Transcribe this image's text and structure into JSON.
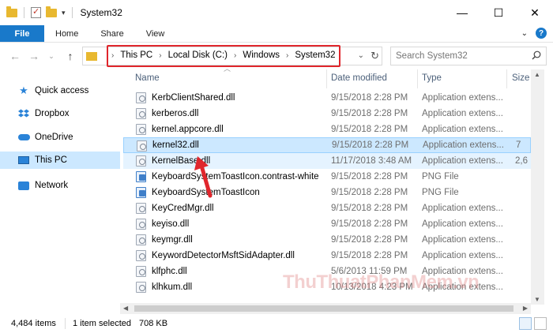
{
  "window": {
    "title": "System32",
    "controls": {
      "minimize": "—",
      "maximize": "☐",
      "close": "✕"
    }
  },
  "ribbon": {
    "tabs": [
      "File",
      "Home",
      "Share",
      "View"
    ],
    "expand_icon": "chevron-down-icon",
    "help_label": "?"
  },
  "address": {
    "crumbs": [
      "This PC",
      "Local Disk (C:)",
      "Windows",
      "System32"
    ],
    "highlight_color": "#e0262c"
  },
  "search": {
    "placeholder": "Search System32"
  },
  "sidebar": {
    "items": [
      {
        "label": "Quick access",
        "icon": "star-icon"
      },
      {
        "label": "Dropbox",
        "icon": "dropbox-icon"
      },
      {
        "label": "OneDrive",
        "icon": "cloud-icon"
      },
      {
        "label": "This PC",
        "icon": "computer-icon",
        "selected": true
      },
      {
        "label": "Network",
        "icon": "network-icon"
      }
    ]
  },
  "columns": {
    "name": "Name",
    "date": "Date modified",
    "type": "Type",
    "size": "Size"
  },
  "files": [
    {
      "name": "KerbClientShared.dll",
      "date": "9/15/2018 2:28 PM",
      "type": "Application extens...",
      "size": "",
      "icon": "dll-file-icon"
    },
    {
      "name": "kerberos.dll",
      "date": "9/15/2018 2:28 PM",
      "type": "Application extens...",
      "size": "",
      "icon": "dll-file-icon"
    },
    {
      "name": "kernel.appcore.dll",
      "date": "9/15/2018 2:28 PM",
      "type": "Application extens...",
      "size": "",
      "icon": "dll-file-icon"
    },
    {
      "name": "kernel32.dll",
      "date": "9/15/2018 2:28 PM",
      "type": "Application extens...",
      "size": "7",
      "icon": "dll-file-icon",
      "selected": true
    },
    {
      "name": "KernelBase.dll",
      "date": "11/17/2018 3:48 AM",
      "type": "Application extens...",
      "size": "2,6",
      "icon": "dll-file-icon",
      "hover": true
    },
    {
      "name": "KeyboardSystemToastIcon.contrast-white",
      "date": "9/15/2018 2:28 PM",
      "type": "PNG File",
      "size": "",
      "icon": "png-file-icon"
    },
    {
      "name": "KeyboardSystemToastIcon",
      "date": "9/15/2018 2:28 PM",
      "type": "PNG File",
      "size": "",
      "icon": "png-file-icon"
    },
    {
      "name": "KeyCredMgr.dll",
      "date": "9/15/2018 2:28 PM",
      "type": "Application extens...",
      "size": "",
      "icon": "dll-file-icon"
    },
    {
      "name": "keyiso.dll",
      "date": "9/15/2018 2:28 PM",
      "type": "Application extens...",
      "size": "",
      "icon": "dll-file-icon"
    },
    {
      "name": "keymgr.dll",
      "date": "9/15/2018 2:28 PM",
      "type": "Application extens...",
      "size": "",
      "icon": "dll-file-icon"
    },
    {
      "name": "KeywordDetectorMsftSidAdapter.dll",
      "date": "9/15/2018 2:28 PM",
      "type": "Application extens...",
      "size": "",
      "icon": "dll-file-icon"
    },
    {
      "name": "klfphc.dll",
      "date": "5/6/2013 11:59 PM",
      "type": "Application extens...",
      "size": "",
      "icon": "dll-file-icon"
    },
    {
      "name": "klhkum.dll",
      "date": "10/13/2018 4:23 PM",
      "type": "Application extens...",
      "size": "",
      "icon": "dll-file-icon"
    }
  ],
  "status": {
    "items_count": "4,484 items",
    "selected": "1 item selected",
    "selected_size": "708 KB"
  },
  "watermark": "ThuThuatPhanMem.vn"
}
